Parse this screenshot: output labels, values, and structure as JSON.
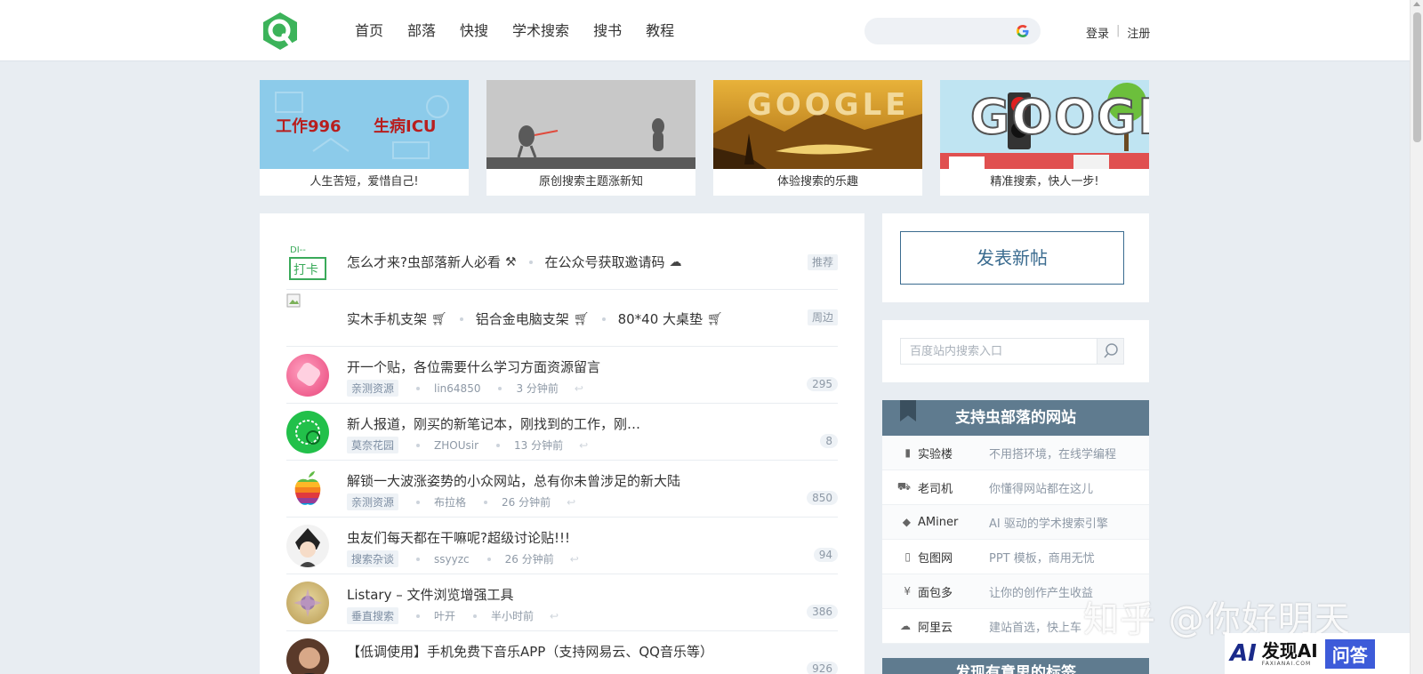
{
  "header": {
    "nav": [
      "首页",
      "部落",
      "快搜",
      "学术搜索",
      "搜书",
      "教程"
    ],
    "auth": {
      "login": "登录",
      "sep": "|",
      "register": "注册"
    }
  },
  "banners": [
    {
      "caption": "人生苦短，爱惜自己!",
      "art_text_1": "工作996",
      "art_text_2": "生病ICU"
    },
    {
      "caption": "原创搜索主题涨新知"
    },
    {
      "caption": "体验搜索的乐趣",
      "art_text": "GOOGLE"
    },
    {
      "caption": "精准搜索，快人一步!",
      "art_text": "GOOGLE"
    }
  ],
  "pinned": [
    {
      "avatar_text": "DI--打卡",
      "links": [
        "怎么才来?虫部落新人必看",
        "在公众号获取邀请码"
      ],
      "icons": [
        "hammer-icon",
        "wechat-icon"
      ],
      "badge": "推荐"
    },
    {
      "links": [
        "实木手机支架",
        "铝合金电脑支架",
        "80*40 大桌垫"
      ],
      "icons": [
        "cart-icon",
        "cart-icon",
        "cart-icon"
      ],
      "badge": "周边"
    }
  ],
  "posts": [
    {
      "title": "开一个贴，各位需要什么学习方面资源留言",
      "tag": "亲测资源",
      "author": "lin64850",
      "time": "3 分钟前",
      "count": "295"
    },
    {
      "title": "新人报道，刚买的新笔记本，刚找到的工作，刚…",
      "tag": "莫奈花园",
      "author": "ZHOUsir",
      "time": "13 分钟前",
      "count": "8"
    },
    {
      "title": "解锁一大波涨姿势的小众网站，总有你未曾涉足的新大陆",
      "tag": "亲测资源",
      "author": "布拉格",
      "time": "26 分钟前",
      "count": "850"
    },
    {
      "title": "虫友们每天都在干嘛呢?超级讨论贴!!!",
      "tag": "搜索杂谈",
      "author": "ssyyzc",
      "time": "26 分钟前",
      "count": "94"
    },
    {
      "title": "Listary – 文件浏览增强工具",
      "tag": "垂直搜索",
      "author": "叶开",
      "time": "半小时前",
      "count": "386"
    },
    {
      "title": "【低调使用】手机免费下音乐APP（支持网易云、QQ音乐等）",
      "tag": "",
      "author": "",
      "time": "",
      "count": "926"
    }
  ],
  "sidebar": {
    "post_button": "发表新帖",
    "search_placeholder": "百度站内搜索入口",
    "support_title": "支持虫部落的网站",
    "support_items": [
      {
        "icon": "building-icon",
        "name": "实验楼",
        "desc": "不用搭环境，在线学编程"
      },
      {
        "icon": "car-icon",
        "name": "老司机",
        "desc": "你懂得网站都在这儿"
      },
      {
        "icon": "graduation-cap-icon",
        "name": "AMiner",
        "desc": "AI 驱动的学术搜索引擎"
      },
      {
        "icon": "file-icon",
        "name": "包图网",
        "desc": "PPT 模板，商用无忧"
      },
      {
        "icon": "yen-icon",
        "name": "面包多",
        "desc": "让你的创作产生收益"
      },
      {
        "icon": "cloud-icon",
        "name": "阿里云",
        "desc": "建站首选，快上车"
      }
    ],
    "next_title": "发现有意思的标签"
  },
  "watermark": {
    "zhihu": "知乎 @你好明天",
    "ai_logo": "AI",
    "ai_name": "发现AI",
    "ai_domain": "FAXIANAI.COM",
    "ai_qa": "问答"
  },
  "colors": {
    "accent": "#3a6b8f",
    "panel_head": "#5f7b8f",
    "bg": "#e8edf2",
    "logo_green": "#3cb35a"
  }
}
